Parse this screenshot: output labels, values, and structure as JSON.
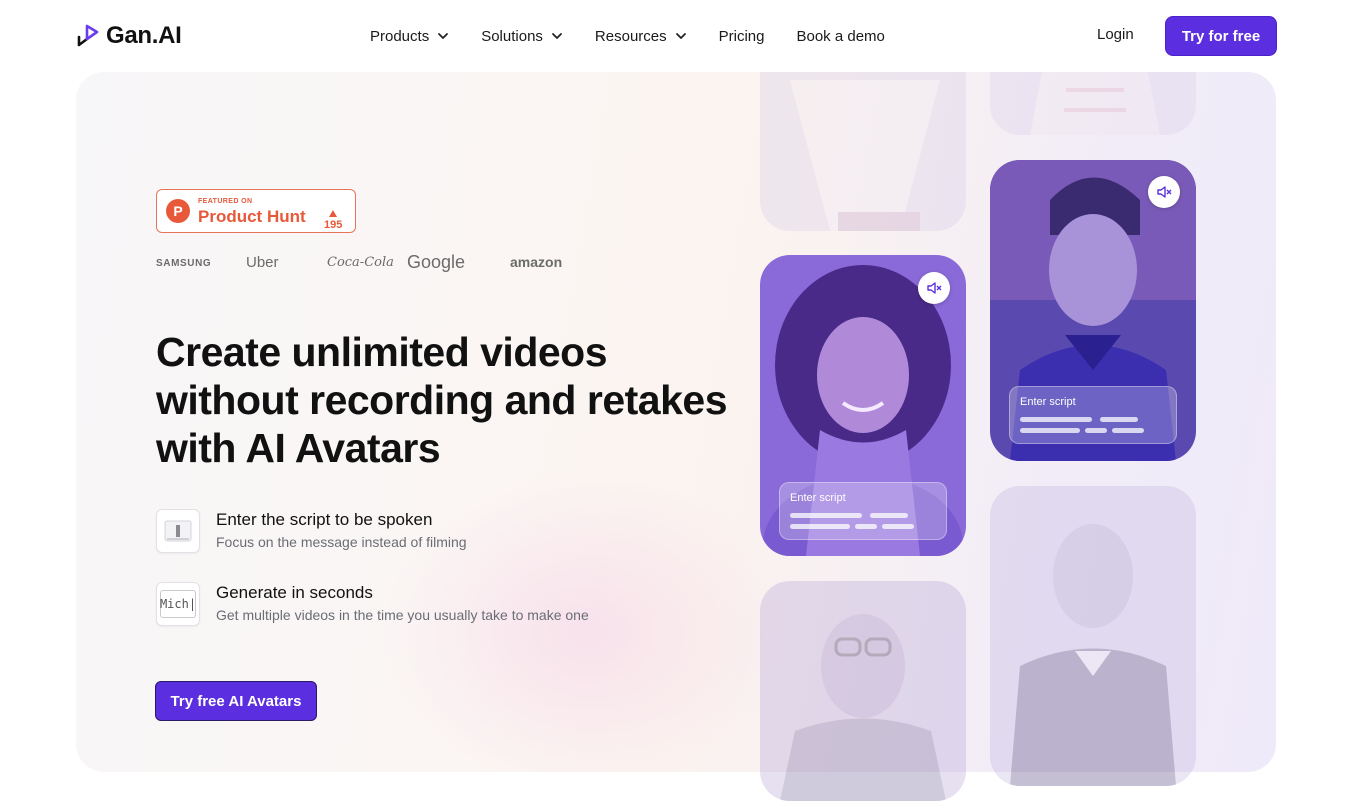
{
  "nav": {
    "logo_text": "Gan.AI",
    "menu": [
      {
        "label": "Products",
        "has_dropdown": true
      },
      {
        "label": "Solutions",
        "has_dropdown": true
      },
      {
        "label": "Resources",
        "has_dropdown": true
      },
      {
        "label": "Pricing",
        "has_dropdown": false
      },
      {
        "label": "Book a demo",
        "has_dropdown": false
      }
    ],
    "login_label": "Login",
    "cta_label": "Try for free"
  },
  "hero": {
    "badge": {
      "featured_on": "FEATURED ON",
      "name": "Product Hunt",
      "upvotes": "195"
    },
    "brands": [
      "SAMSUNG",
      "Uber",
      "Coca-Cola",
      "Google",
      "amazon"
    ],
    "headline": "Create unlimited videos without recording and retakes with AI Avatars",
    "features": [
      {
        "title": "Enter the script to be spoken",
        "subtitle": "Focus on the message instead of filming"
      },
      {
        "title": "Generate in seconds",
        "subtitle": "Get multiple videos in the time you usually take to make one",
        "icon_text": "Mich|"
      }
    ],
    "cta_label": "Try free AI Avatars"
  },
  "videos": {
    "script_label": "Enter script"
  },
  "colors": {
    "accent": "#5b2fe0",
    "product_hunt": "#e8593a",
    "card_overlay": "#7b5ce6"
  }
}
